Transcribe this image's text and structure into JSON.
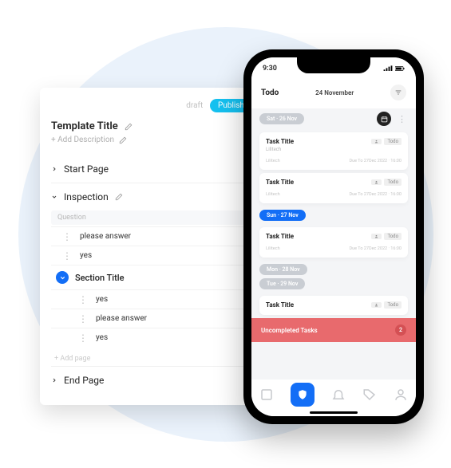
{
  "editor": {
    "tabs": {
      "draft": "draft",
      "publish": "Publish"
    },
    "title": "Template Title",
    "add_description": "+ Add Description",
    "start_page": "Start Page",
    "inspection": "Inspection",
    "question_label": "Question",
    "rows": {
      "r0": "please answer",
      "r1": "yes",
      "section": "Section Title",
      "r2": "yes",
      "r3": "please answer",
      "r4": "yes"
    },
    "add_page": "+ Add page",
    "end_page": "End Page"
  },
  "phone": {
    "status": {
      "time": "9:30"
    },
    "header": {
      "title": "Todo",
      "date": "24 November"
    },
    "pills": {
      "d1": "Sat · 26 Nov",
      "d2": "Sun · 27 Nov",
      "d3": "Mon · 28 Nov",
      "d4": "Tue · 29 Nov"
    },
    "task": {
      "title": "Task Title",
      "badge": "Todo",
      "sub": "Lilitech",
      "due": "Due To 27Dec 2022 · 16:00"
    },
    "banner": {
      "label": "Uncompleted Tasks",
      "count": "2"
    }
  }
}
